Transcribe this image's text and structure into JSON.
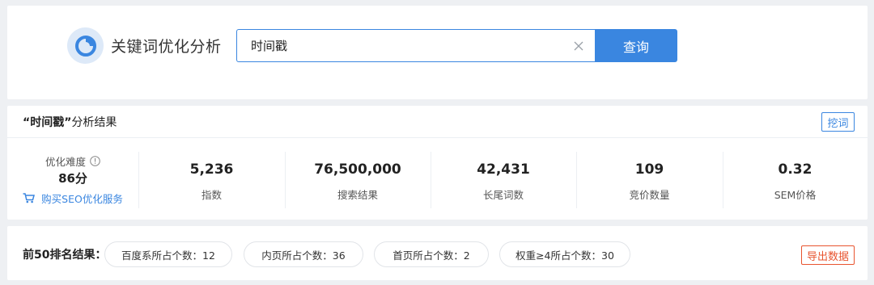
{
  "header": {
    "brand_title": "关键词优化分析",
    "search_value": "时间戳",
    "query_label": "查询"
  },
  "analysis": {
    "keyword_quoted": "“时间戳”",
    "title_suffix": "分析结果",
    "mine_label": "挖词",
    "difficulty": {
      "label": "优化难度",
      "value": "86分",
      "buy_link": "购买SEO优化服务"
    },
    "metrics": [
      {
        "value": "5,236",
        "label": "指数"
      },
      {
        "value": "76,500,000",
        "label": "搜索结果"
      },
      {
        "value": "42,431",
        "label": "长尾词数"
      },
      {
        "value": "109",
        "label": "竞价数量"
      },
      {
        "value": "0.32",
        "label": "SEM价格"
      }
    ]
  },
  "top50": {
    "label": "前50排名结果：",
    "pills": [
      "百度系所占个数：12",
      "内页所占个数：36",
      "首页所占个数：2",
      "权重≥4所占个数：30"
    ],
    "export_label": "导出数据"
  },
  "colors": {
    "accent": "#3a86e0",
    "export": "#e8542f",
    "background": "#eef0f3"
  },
  "icons": [
    "pie-chart-logo-icon",
    "clear-icon",
    "info-icon",
    "cart-icon"
  ]
}
